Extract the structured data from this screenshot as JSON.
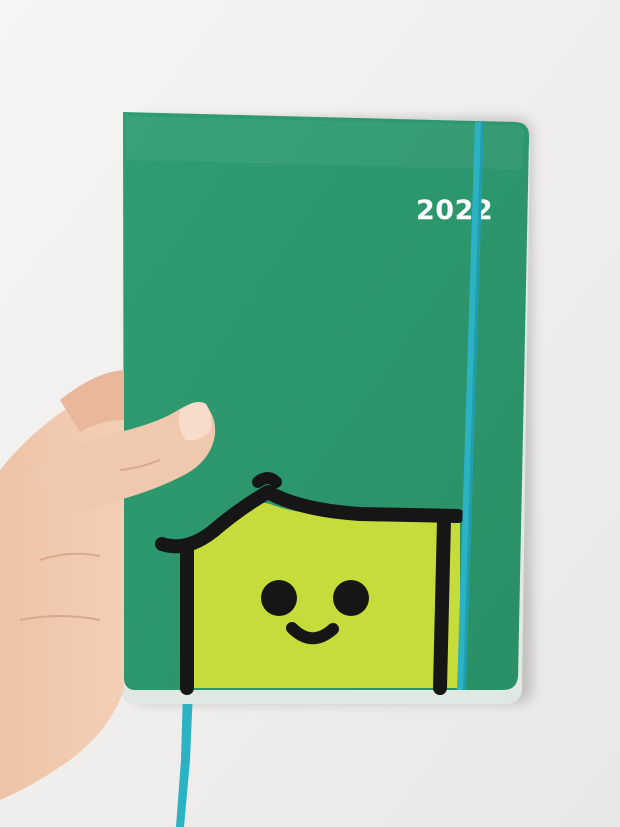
{
  "notebook": {
    "year_label": "2022",
    "cover_color": "#2e9a6f",
    "band_color": "#2bb3c4",
    "character_face_color": "#c5dc3a",
    "outline_color": "#161616"
  },
  "background_color": "#f1f0ee",
  "skin_color": "#f0c8ad"
}
